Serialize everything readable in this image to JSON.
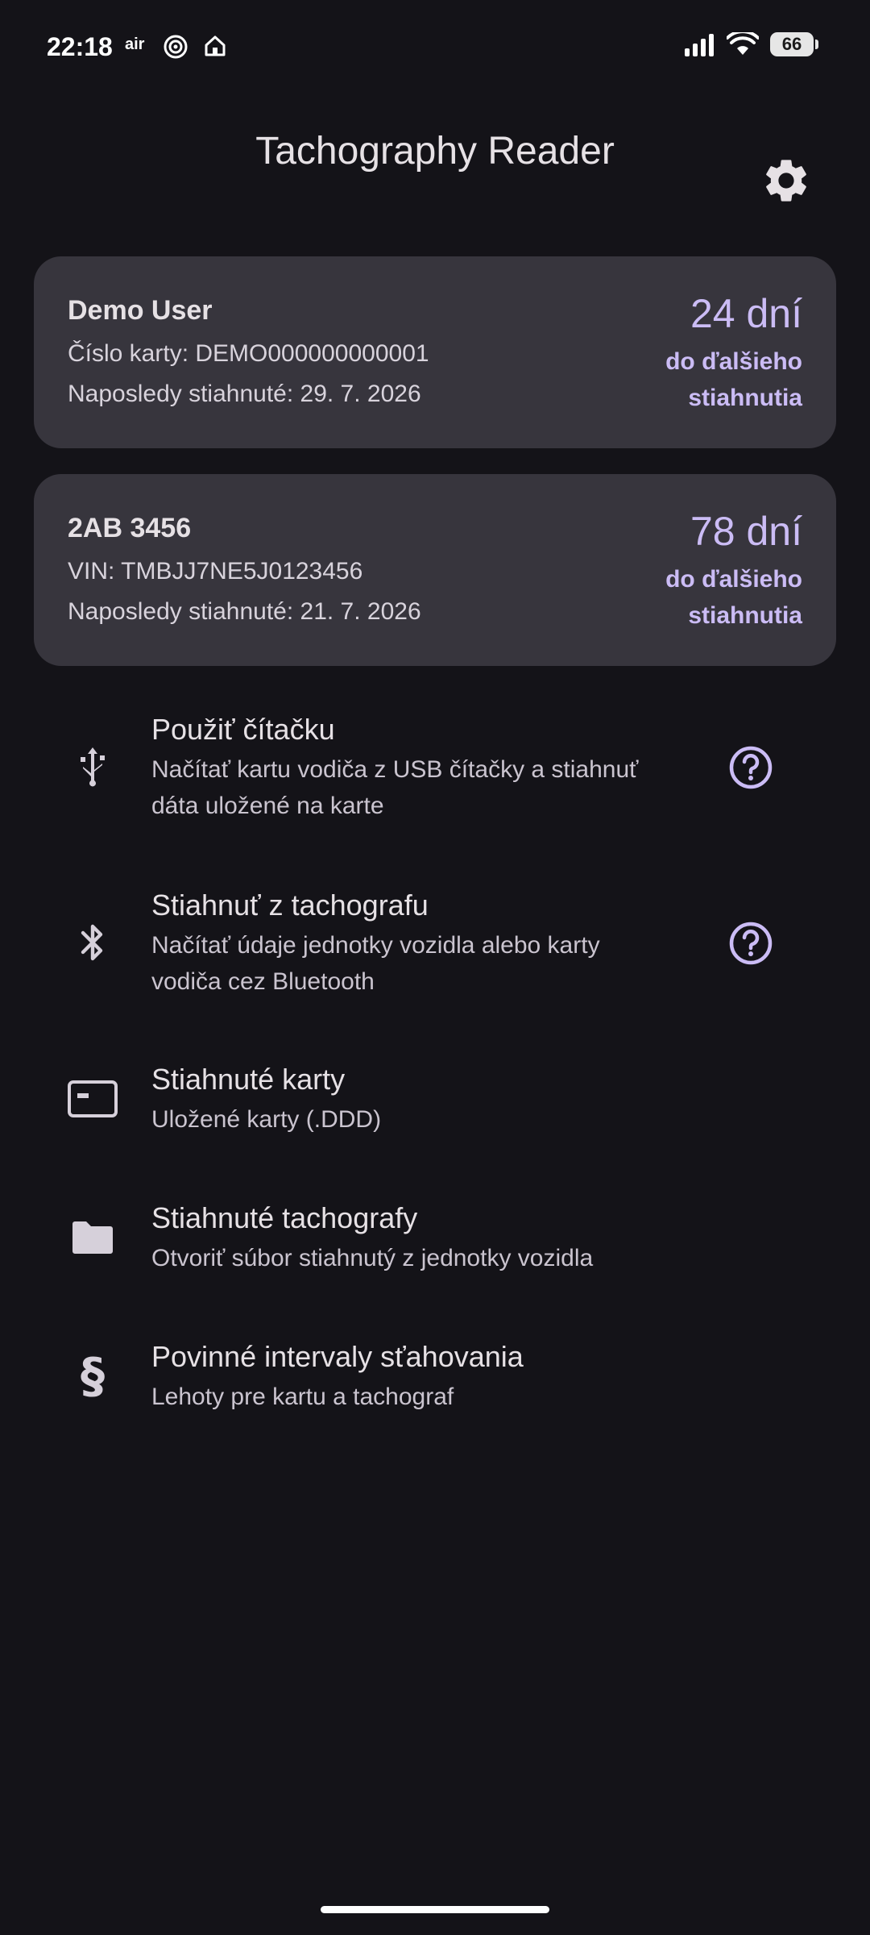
{
  "status_bar": {
    "time": "22:18",
    "carrier_badge": "air",
    "battery": "66"
  },
  "app": {
    "title": "Tachography Reader"
  },
  "cards": [
    {
      "title": "Demo User",
      "line1": "Číslo karty: DEMO000000000001",
      "line2": "Naposledy stiahnuté: 29. 7. 2026",
      "days": "24 dní",
      "days_sub": "do ďalšieho stiahnutia"
    },
    {
      "title": "2AB 3456",
      "line1": "VIN: TMBJJ7NE5J0123456",
      "line2": "Naposledy stiahnuté: 21. 7. 2026",
      "days": "78 dní",
      "days_sub": "do ďalšieho stiahnutia"
    }
  ],
  "menu": [
    {
      "icon": "usb-icon",
      "title": "Použiť čítačku",
      "subtitle": "Načítať kartu vodiča z USB čítačky a stiahnuť dáta uložené na karte"
    },
    {
      "icon": "bluetooth-icon",
      "title": "Stiahnuť z tachografu",
      "subtitle": "Načítať údaje jednotky vozidla alebo karty vodiča cez Bluetooth"
    },
    {
      "icon": "card-icon",
      "title": "Stiahnuté karty",
      "subtitle": "Uložené karty (.DDD)"
    },
    {
      "icon": "folder-icon",
      "title": "Stiahnuté tachografy",
      "subtitle": "Otvoriť súbor stiahnutý z jednotky vozidla"
    },
    {
      "icon": "section-sign-icon",
      "title": "Povinné intervaly sťahovania",
      "subtitle": "Lehoty pre kartu a tachograf"
    }
  ],
  "colors": {
    "background": "#141318",
    "card": "#37353d",
    "accent": "#cbbcf5",
    "text": "#e6e1e5"
  }
}
